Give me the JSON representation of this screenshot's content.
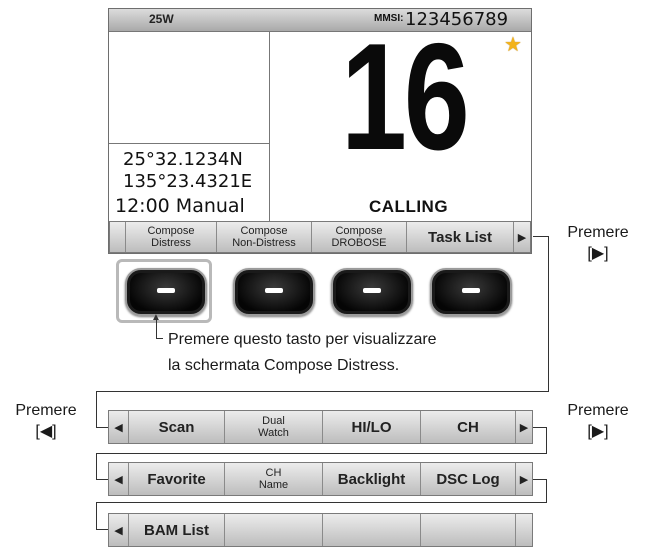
{
  "status": {
    "power": "25W",
    "mmsi_label": "MMSI:",
    "mmsi_value": "123456789"
  },
  "position": {
    "latitude": "25°32.1234N",
    "longitude": "135°23.4321E"
  },
  "time": "12:00 Manual",
  "channel": "16",
  "channel_status": "CALLING",
  "lcd_softkeys": [
    {
      "line1": "Compose",
      "line2": "Distress"
    },
    {
      "line1": "Compose",
      "line2": "Non-Distress"
    },
    {
      "line1": "Compose",
      "line2": "DROBOSE"
    },
    {
      "label": "Task List"
    }
  ],
  "rows": {
    "row1": [
      {
        "label": "Scan"
      },
      {
        "line1": "Dual",
        "line2": "Watch"
      },
      {
        "label": "HI/LO"
      },
      {
        "label": "CH"
      }
    ],
    "row2": [
      {
        "label": "Favorite"
      },
      {
        "line1": "CH",
        "line2": "Name"
      },
      {
        "label": "Backlight"
      },
      {
        "label": "DSC Log"
      }
    ],
    "row3": [
      {
        "label": "BAM List"
      }
    ]
  },
  "annotations": {
    "key_note_line1": "Premere questo tasto per visualizzare",
    "key_note_line2": "la schermata Compose Distress.",
    "press_right_top": "Premere",
    "press_right_top_key": "[▶]",
    "press_left": "Premere",
    "press_left_key": "[◀]",
    "press_right_mid": "Premere",
    "press_right_mid_key": "[▶]"
  },
  "icons": {
    "favorite": "star-icon",
    "scroll_left": "left-arrow-icon",
    "scroll_right": "right-arrow-icon"
  },
  "colors": {
    "star": "#f3b31a",
    "softkey_bg": "#d0d0d0"
  }
}
